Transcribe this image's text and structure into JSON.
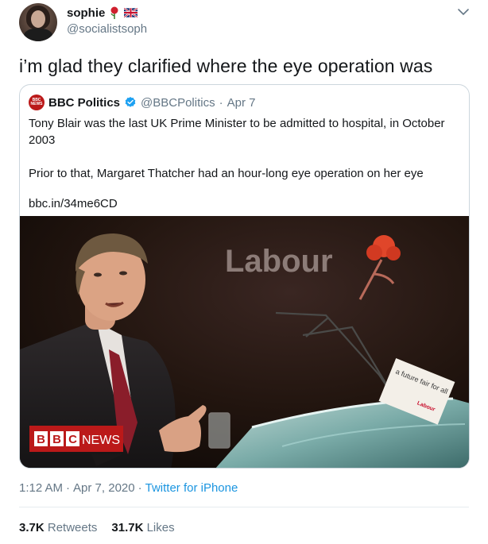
{
  "author": {
    "display_name": "sophie",
    "handle": "@socialistsoph",
    "emoji": [
      "rose",
      "union-jack-flag"
    ]
  },
  "tweet": {
    "text": "i’m glad they clarified where the eye operation was",
    "time": "1:12 AM",
    "date": "Apr 7, 2020",
    "source": "Twitter for iPhone",
    "retweets_count": "3.7K",
    "retweets_label": "Retweets",
    "likes_count": "31.7K",
    "likes_label": "Likes"
  },
  "quoted": {
    "avatar_text": "BBC NEWS",
    "name": "BBC Politics",
    "verified": true,
    "handle": "@BBCPolitics",
    "date": "Apr 7",
    "paragraph1": "Tony Blair was the last UK Prime Minister to be admitted to hospital, in October 2003",
    "paragraph2": "Prior to that, Margaret Thatcher had an hour-long eye operation on her eye",
    "link": "bbc.in/34me6CD",
    "image": {
      "backdrop_text": "Labour",
      "podium_sign": "a future fair for all",
      "podium_sign_brand": "Labour",
      "bbc_letters": [
        "B",
        "B",
        "C"
      ],
      "news_label": "NEWS"
    }
  },
  "colors": {
    "link_blue": "#1b95e0",
    "secondary_text": "#657786",
    "bbc_red": "#bb1919",
    "border": "#ccd6dd"
  }
}
